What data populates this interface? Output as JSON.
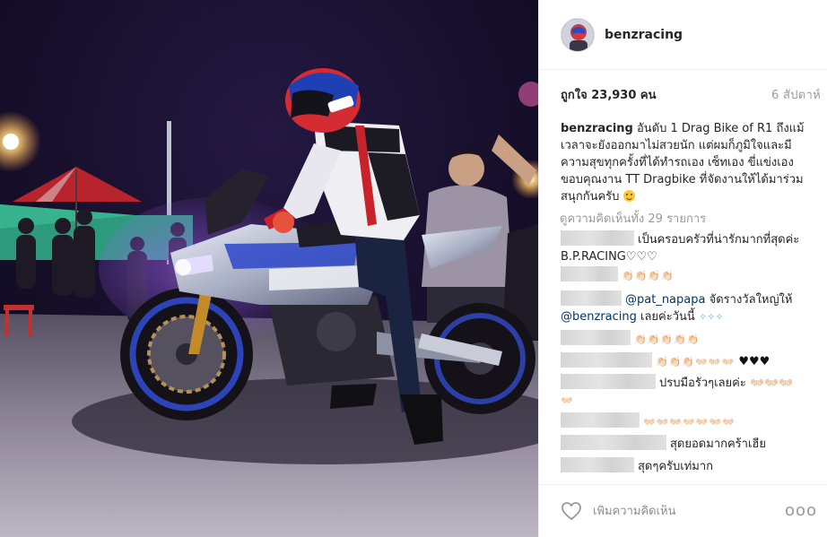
{
  "header": {
    "username": "benzracing"
  },
  "post": {
    "likes_label": "ถูกใจ 23,930 คน",
    "time_ago": "6 สัปดาห์",
    "caption_username": "benzracing",
    "caption_text": "อันดับ 1 Drag Bike of R1 ถึงแม้เวลาจะยังออกมาไม่สวยนัก แต่ผมก็ภูมิใจและมีความสุขทุกครั้งที่ได้ทำรถเอง เซ็ทเอง ขี่แข่งเอง ขอบคุณงาน TT Dragbike ที่จัดงานให้ได้มาร่วมสนุกกันครับ",
    "view_all_comments": "ดูความคิดเห็นทั้ง 29 รายการ"
  },
  "comments": [
    {
      "text": "เป็นครอบครัวที่น่ารักมากที่สุดค่ะ B.P.RACING♡♡♡"
    },
    {
      "text": "👏🏻👏🏻👏🏻👏🏻"
    },
    {
      "mention1": "@pat_napapa",
      "text1": "จัดรางวัลใหญ่ให้",
      "mention2": "@benzracing",
      "text2": "เลยค่ะวันนี้"
    },
    {
      "text": "👏🏻👏🏻👏🏻👏🏻👏🏻"
    },
    {
      "text": "👏🏻👏🏻👏🏻👐🏻👐🏻👐🏻",
      "hearts": "♥♥♥"
    },
    {
      "text": "ปรบมือรัวๆเลยค่ะ 👐🏻👐🏻👐🏻",
      "text_line2": "👐🏻"
    },
    {
      "text": "👐🏻👐🏻👐🏻👐🏻👐🏻👐🏻👐🏻"
    },
    {
      "text": "สุดยอดมากคร้าเฮีย"
    },
    {
      "text": "สุดๆครับเท่มาก"
    }
  ],
  "actions": {
    "comment_placeholder": "เพิ่มความคิดเห็น",
    "more_label": "ooo"
  },
  "icons": {
    "like": "heart-outline-icon",
    "more": "more-options-icon"
  },
  "colors": {
    "mention": "#003569",
    "muted": "#999999",
    "text": "#262626"
  }
}
